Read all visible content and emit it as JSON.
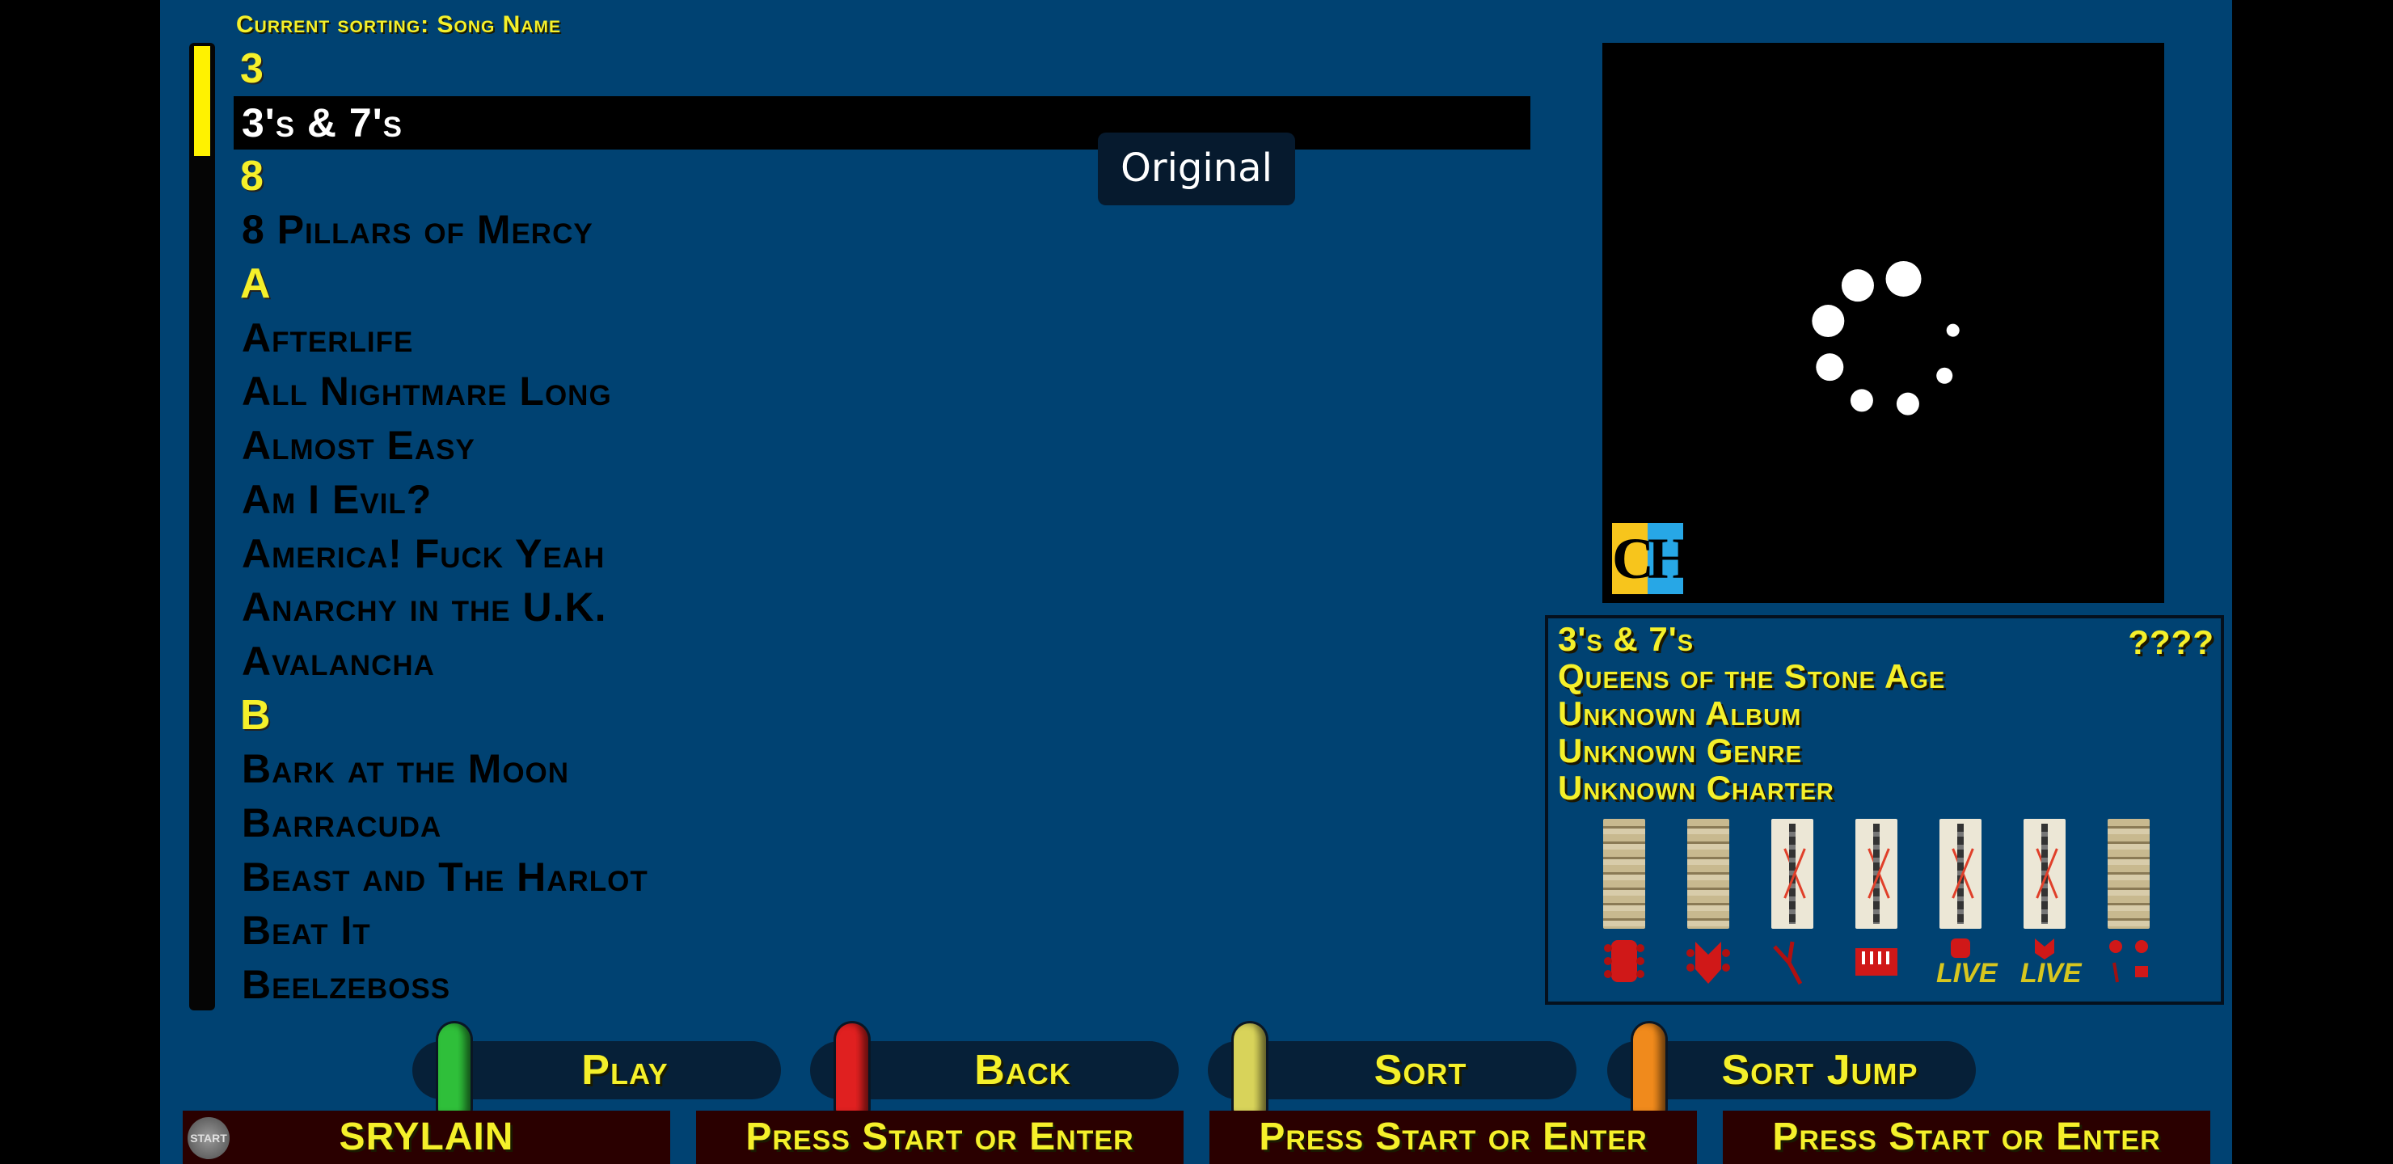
{
  "app": {
    "name": "Clone Hero",
    "logo_text": [
      "C",
      "H"
    ]
  },
  "colors": {
    "background": "#004272",
    "header_yellow": "#f5f02a",
    "selected_row_bg": "#000000",
    "player_slot_bg": "#2a0000"
  },
  "sorting": {
    "label": "Current sorting: Song Name"
  },
  "overlay_tooltip": "Original",
  "song_list": {
    "scroll_position_fraction": 0.0,
    "rows": [
      {
        "type": "header",
        "text": "3"
      },
      {
        "type": "song",
        "text": "3's & 7's",
        "selected": true
      },
      {
        "type": "header",
        "text": "8"
      },
      {
        "type": "song",
        "text": "8 Pillars of Mercy"
      },
      {
        "type": "header",
        "text": "A"
      },
      {
        "type": "song",
        "text": "Afterlife"
      },
      {
        "type": "song",
        "text": "All Nightmare Long"
      },
      {
        "type": "song",
        "text": "Almost Easy"
      },
      {
        "type": "song",
        "text": "Am I Evil?"
      },
      {
        "type": "song",
        "text": "America! Fuck Yeah"
      },
      {
        "type": "song",
        "text": "Anarchy in the U.K."
      },
      {
        "type": "song",
        "text": "Avalancha"
      },
      {
        "type": "header",
        "text": "B"
      },
      {
        "type": "song",
        "text": "Bark at the Moon"
      },
      {
        "type": "song",
        "text": "Barracuda"
      },
      {
        "type": "song",
        "text": "Beast and The Harlot"
      },
      {
        "type": "song",
        "text": "Beat It"
      },
      {
        "type": "song",
        "text": "Beelzeboss"
      }
    ]
  },
  "album_art": {
    "state": "loading",
    "spinner_icon": "loading-spinner-icon"
  },
  "song_info": {
    "title": "3's & 7's",
    "year": "????",
    "artist": "Queens of the Stone Age",
    "album": "Unknown Album",
    "genre": "Unknown Genre",
    "charter": "Unknown Charter",
    "instruments": [
      {
        "name": "guitar",
        "icon": "guitar-icon",
        "available": true,
        "live_label": ""
      },
      {
        "name": "bass",
        "icon": "bass-icon",
        "available": true,
        "live_label": ""
      },
      {
        "name": "rhythm",
        "icon": "rhythm-guitar-icon",
        "available": false,
        "live_label": ""
      },
      {
        "name": "keys",
        "icon": "keys-icon",
        "available": false,
        "live_label": ""
      },
      {
        "name": "guitar-ghl",
        "icon": "ghl-guitar-icon",
        "available": false,
        "live_label": "LIVE"
      },
      {
        "name": "bass-ghl",
        "icon": "ghl-bass-icon",
        "available": false,
        "live_label": "LIVE"
      },
      {
        "name": "drums",
        "icon": "drums-icon",
        "available": true,
        "live_label": ""
      }
    ]
  },
  "action_buttons": [
    {
      "label": "Play",
      "fret_color": "#2fbf3a",
      "icon": "green-fret-icon"
    },
    {
      "label": "Back",
      "fret_color": "#e02020",
      "icon": "red-fret-icon"
    },
    {
      "label": "Sort",
      "fret_color": "#d8d35a",
      "icon": "yellow-fret-icon"
    },
    {
      "label": "Sort Jump",
      "fret_color": "#f08a1c",
      "icon": "orange-fret-icon"
    }
  ],
  "players": [
    {
      "label": "SRYLAIN",
      "badge": "START"
    },
    {
      "label": "Press Start or Enter"
    },
    {
      "label": "Press Start or Enter"
    },
    {
      "label": "Press Start or Enter"
    }
  ]
}
